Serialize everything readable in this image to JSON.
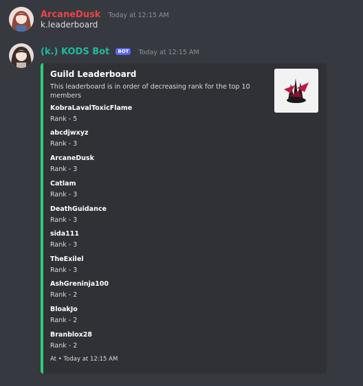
{
  "messages": [
    {
      "username": "ArcaneDusk",
      "username_color": "#ed4245",
      "timestamp": "Today at 12:15 AM",
      "content": "k.leaderboard"
    },
    {
      "username": "(k.) KODS Bot",
      "username_color": "#1abc9c",
      "bot_tag": "BOT",
      "timestamp": "Today at 12:15 AM"
    }
  ],
  "embed": {
    "accent_color": "#2ecc71",
    "title": "Guild Leaderboard",
    "description": "This leaderboard is in order of decreasing rank for the top 10 members",
    "fields": [
      {
        "name": "KobraLavalToxicFlame",
        "value": "Rank - 5"
      },
      {
        "name": "abcdjwxyz",
        "value": "Rank - 3"
      },
      {
        "name": "ArcaneDusk",
        "value": "Rank - 3"
      },
      {
        "name": "Catlam",
        "value": "Rank - 3"
      },
      {
        "name": "DeathGuidance",
        "value": "Rank - 3"
      },
      {
        "name": "sida111",
        "value": "Rank - 3"
      },
      {
        "name": "TheExilel",
        "value": "Rank - 3"
      },
      {
        "name": "AshGreninja100",
        "value": "Rank - 2"
      },
      {
        "name": "BloakJo",
        "value": "Rank - 2"
      },
      {
        "name": "Branblox28",
        "value": "Rank - 2"
      }
    ],
    "footer": "At • Today at 12:15 AM"
  }
}
